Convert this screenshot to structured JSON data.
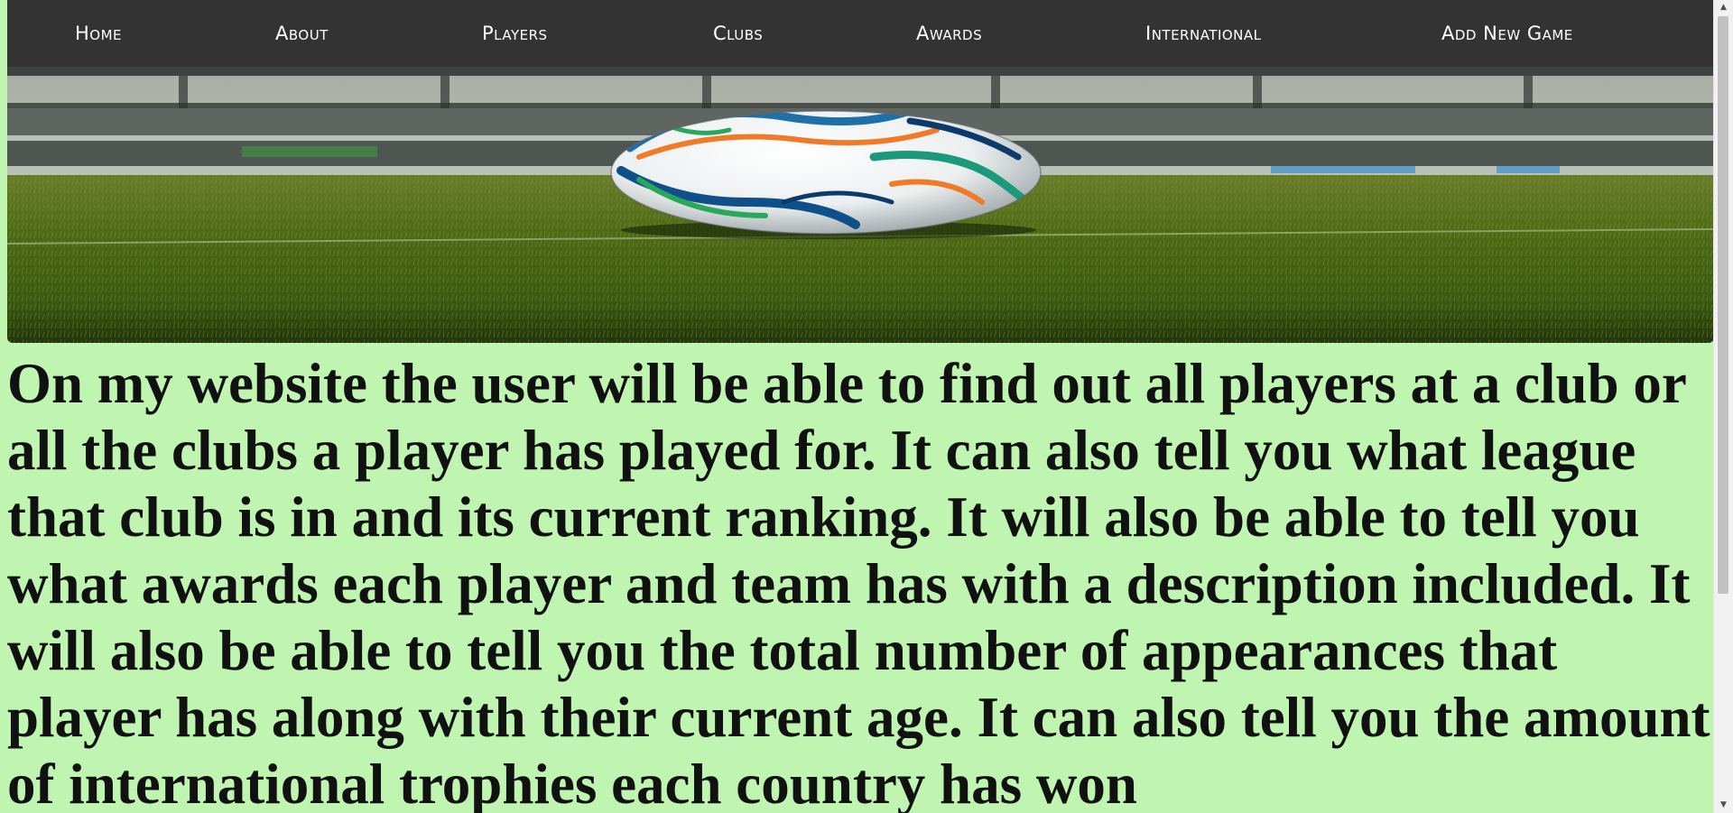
{
  "nav": {
    "items": [
      {
        "label": "Home"
      },
      {
        "label": "About"
      },
      {
        "label": "Players"
      },
      {
        "label": "Clubs"
      },
      {
        "label": "Awards"
      },
      {
        "label": "International"
      },
      {
        "label": "Add New Game"
      }
    ]
  },
  "hero": {
    "icon": "football-on-pitch-image"
  },
  "content": {
    "description": "On my website the user will be able to find out all players at a club or all the clubs a player has played for. It can also tell you what league that club is in and its current ranking. It will also be able to tell you what awards each player and team has with a description included. It will also be able to tell you the total number of appearances that player has along with their current age. It can also tell you the amount of international trophies each country has won"
  },
  "colors": {
    "page_background": "#bff5b0",
    "nav_background": "#333333",
    "nav_text": "#ffffff",
    "body_text": "#111111"
  }
}
